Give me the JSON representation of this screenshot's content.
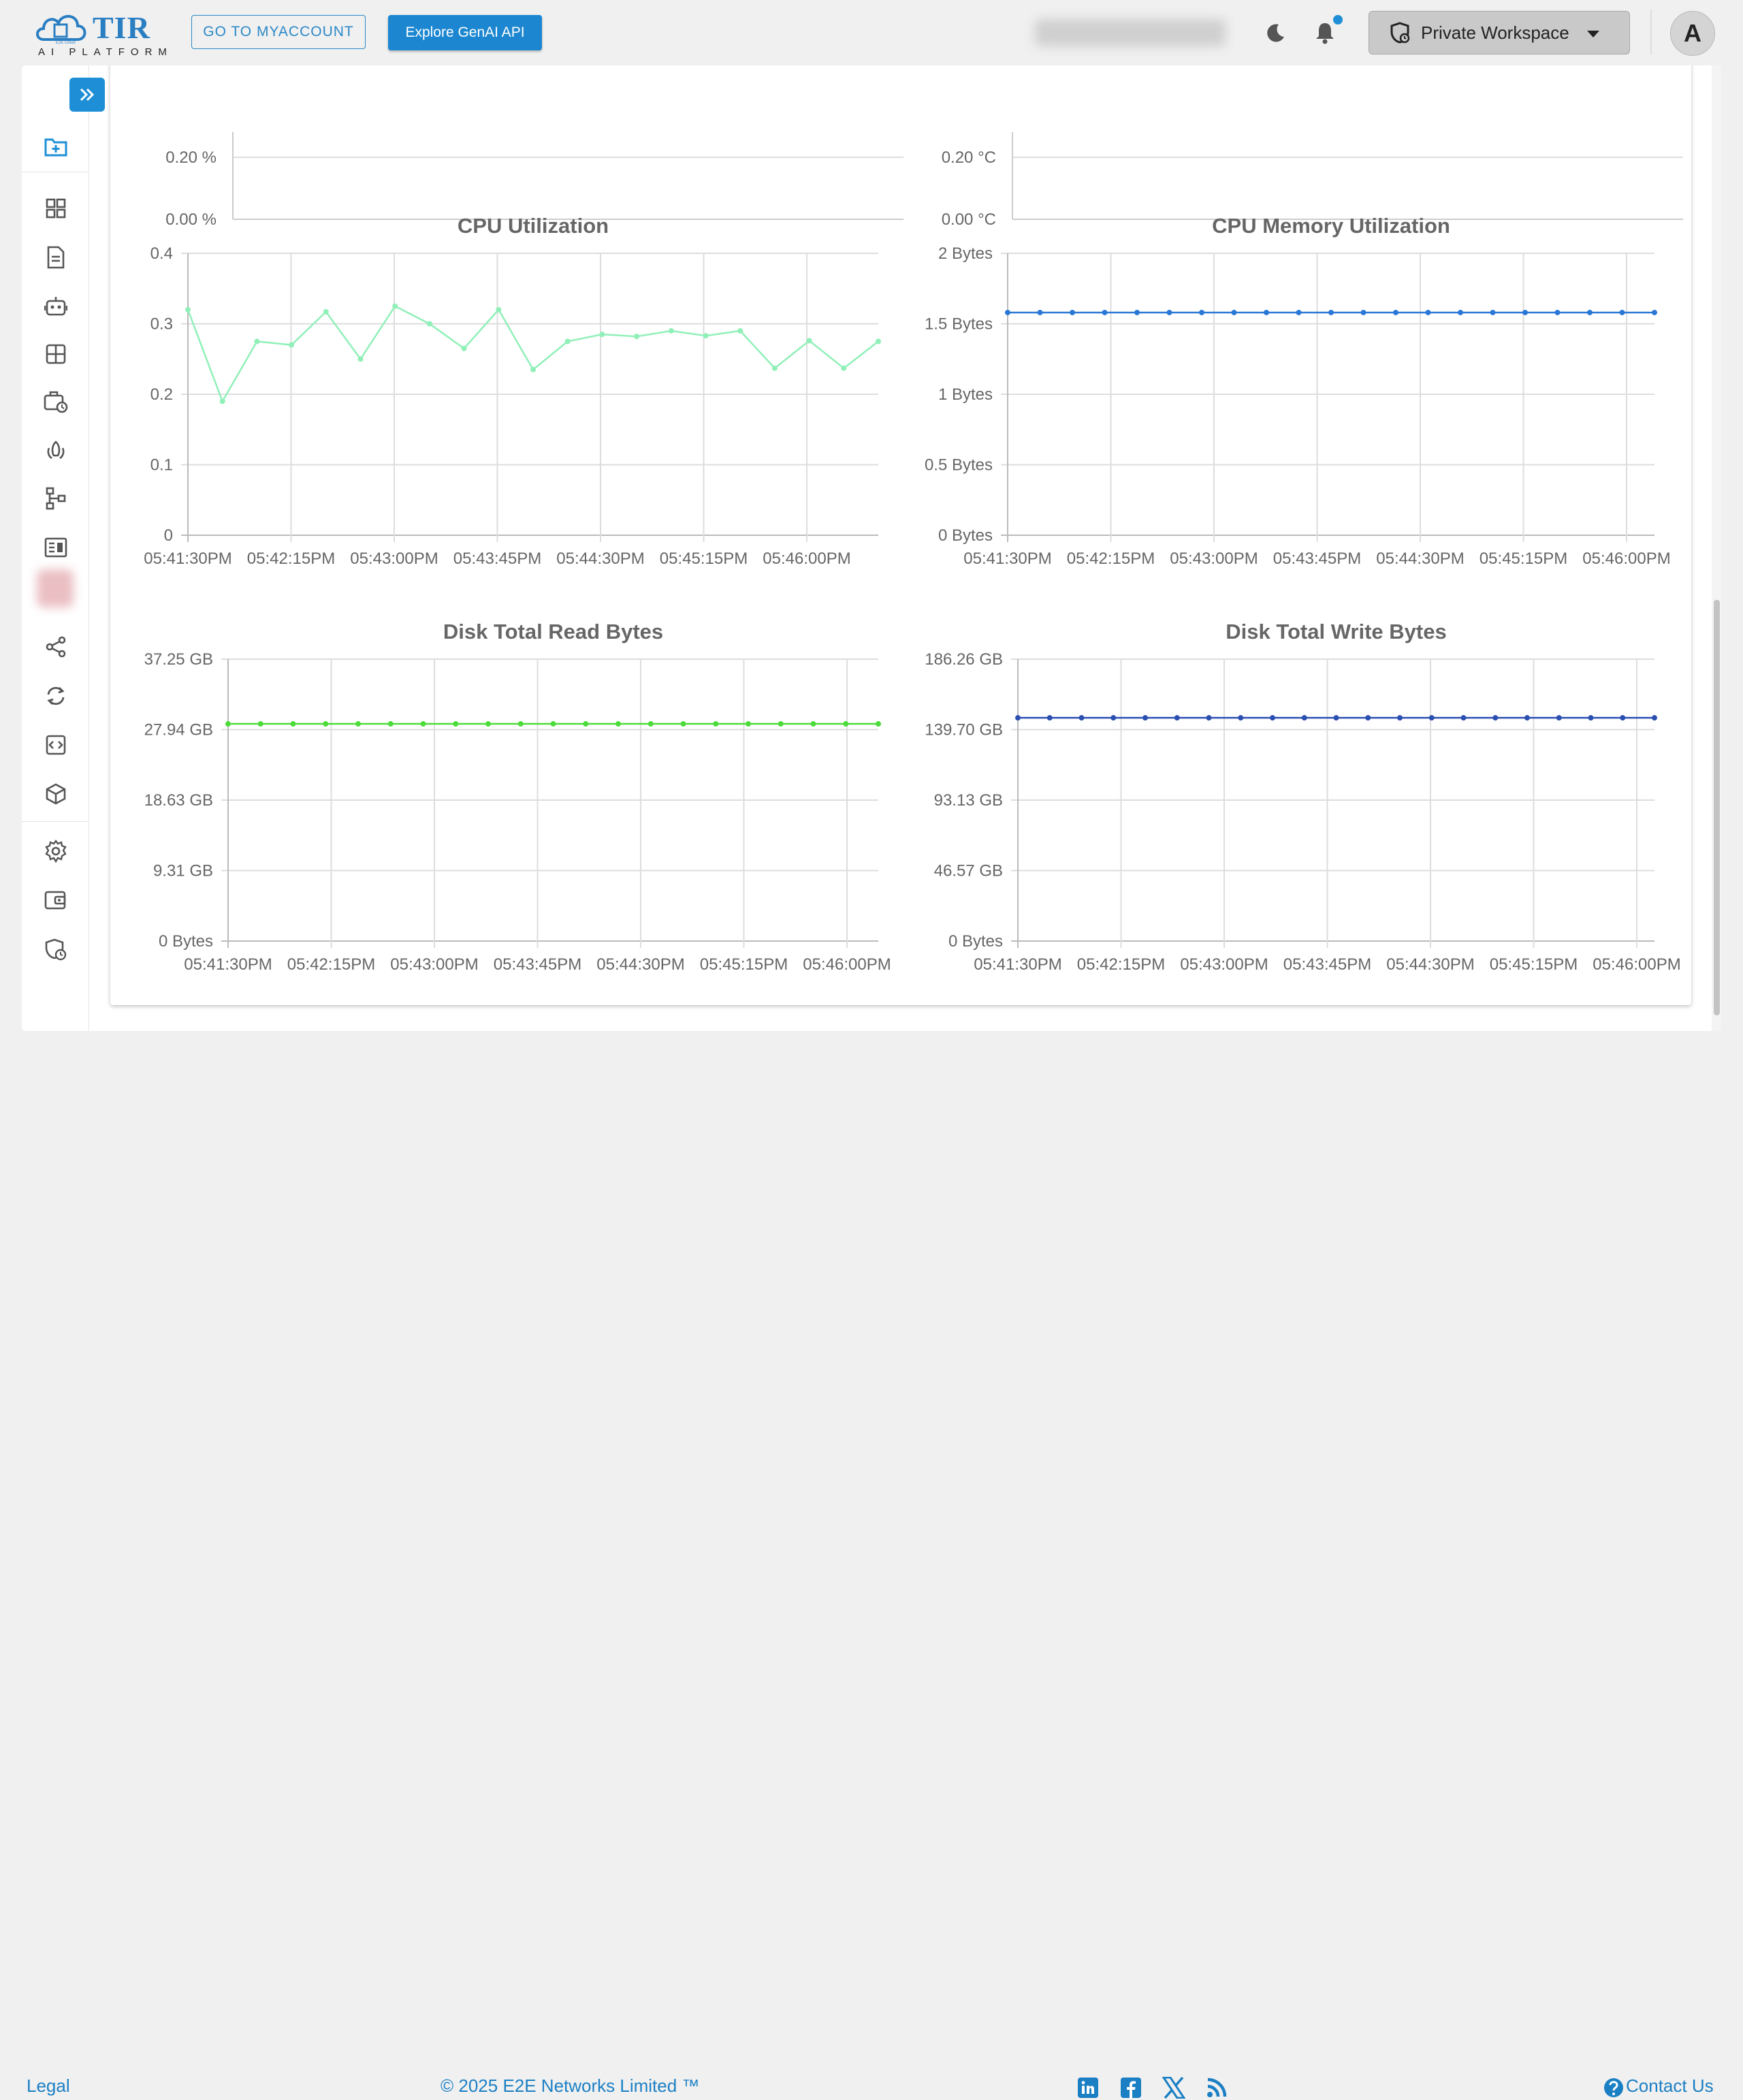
{
  "header": {
    "logo_text": "TIR",
    "logo_sub": "AI PLATFORM",
    "logo_mark": "E2E Cloud",
    "myaccount_label": "GO TO MYACCOUNT",
    "genai_label": "Explore GenAI API",
    "workspace_label": "Private Workspace",
    "avatar_initial": "A",
    "icons": [
      "moon-icon",
      "bell-icon",
      "workspace-icon",
      "chevron-down-icon"
    ]
  },
  "sidebar": {
    "icons": [
      "expand-icon",
      "new-folder-icon",
      "dashboard-icon",
      "document-icon",
      "robot-icon",
      "grid-icon",
      "schedule-icon",
      "rocket-icon",
      "pipeline-icon",
      "report-icon",
      "blurred-icon",
      "share-icon",
      "sync-icon",
      "code-icon",
      "cube-icon",
      "settings-icon",
      "wallet-icon",
      "security-icon"
    ]
  },
  "top_partial_charts": [
    {
      "ticks": [
        "0.20 %",
        "0.00 %"
      ]
    },
    {
      "ticks": [
        "0.20 °C",
        "0.00 °C"
      ]
    }
  ],
  "chart_data": [
    {
      "type": "line",
      "title": "CPU Utilization",
      "x_ticks": [
        "05:41:30PM",
        "05:42:15PM",
        "05:43:00PM",
        "05:43:45PM",
        "05:44:30PM",
        "05:45:15PM",
        "05:46:00PM"
      ],
      "y_ticks": [
        "0",
        "0.1",
        "0.2",
        "0.3",
        "0.4"
      ],
      "ylim": [
        0,
        0.4
      ],
      "point_count": 23,
      "color": "#90f0b8",
      "values": [
        0.32,
        0.19,
        0.275,
        0.27,
        0.317,
        0.25,
        0.325,
        0.3,
        0.265,
        0.32,
        0.235,
        0.275,
        0.285,
        0.282,
        0.29,
        0.283,
        0.29,
        0.237,
        0.276,
        0.237,
        0.275
      ]
    },
    {
      "type": "line",
      "title": "CPU Memory Utilization",
      "x_ticks": [
        "05:41:30PM",
        "05:42:15PM",
        "05:43:00PM",
        "05:43:45PM",
        "05:44:30PM",
        "05:45:15PM",
        "05:46:00PM"
      ],
      "y_ticks": [
        "0 Bytes",
        "0.5 Bytes",
        "1 Bytes",
        "1.5 Bytes",
        "2 Bytes"
      ],
      "ylim": [
        0,
        2
      ],
      "color": "#2a78d6",
      "values": [
        1.58,
        1.58,
        1.58,
        1.58,
        1.58,
        1.58,
        1.58,
        1.58,
        1.58,
        1.58,
        1.58,
        1.58,
        1.58,
        1.58,
        1.58,
        1.58,
        1.58,
        1.58,
        1.58,
        1.58,
        1.58
      ]
    },
    {
      "type": "line",
      "title": "Disk Total Read Bytes",
      "x_ticks": [
        "05:41:30PM",
        "05:42:15PM",
        "05:43:00PM",
        "05:43:45PM",
        "05:44:30PM",
        "05:45:15PM",
        "05:46:00PM"
      ],
      "y_ticks": [
        "0 Bytes",
        "9.31 GB",
        "18.63 GB",
        "27.94 GB",
        "37.25 GB"
      ],
      "ylim": [
        0,
        37.25
      ],
      "color": "#4cdc3a",
      "values": [
        28.7,
        28.7,
        28.7,
        28.7,
        28.7,
        28.7,
        28.7,
        28.7,
        28.7,
        28.7,
        28.7,
        28.7,
        28.7,
        28.7,
        28.7,
        28.7,
        28.7,
        28.7,
        28.7,
        28.7,
        28.7
      ]
    },
    {
      "type": "line",
      "title": "Disk Total Write Bytes",
      "x_ticks": [
        "05:41:30PM",
        "05:42:15PM",
        "05:43:00PM",
        "05:43:45PM",
        "05:44:30PM",
        "05:45:15PM",
        "05:46:00PM"
      ],
      "y_ticks": [
        "0 Bytes",
        "46.57 GB",
        "93.13 GB",
        "139.70 GB",
        "186.26 GB"
      ],
      "ylim": [
        0,
        186.26
      ],
      "color": "#2a4fb0",
      "values": [
        147.5,
        147.5,
        147.5,
        147.5,
        147.5,
        147.5,
        147.5,
        147.5,
        147.5,
        147.5,
        147.5,
        147.5,
        147.5,
        147.5,
        147.5,
        147.5,
        147.5,
        147.5,
        147.5,
        147.5,
        147.5
      ]
    }
  ],
  "footer": {
    "legal": "Legal",
    "copyright": "© 2025 E2E Networks Limited ™",
    "contact": "Contact Us",
    "social": [
      "linkedin-icon",
      "facebook-icon",
      "x-icon",
      "rss-icon"
    ]
  },
  "colors": {
    "accent": "#1e8fd6",
    "link": "#1b7fc4"
  }
}
